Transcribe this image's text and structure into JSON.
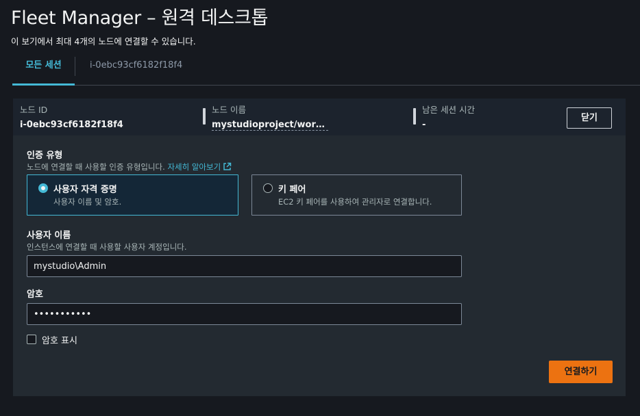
{
  "page": {
    "title": "Fleet Manager – 원격 데스크톱",
    "subtitle": "이 보기에서 최대 4개의 노드에 연결할 수 있습니다."
  },
  "tabs": [
    {
      "label": "모든 세션",
      "active": true
    },
    {
      "label": "i-0ebc93cf6182f18f4",
      "active": false
    }
  ],
  "header": {
    "node_id_label": "노드 ID",
    "node_id_value": "i-0ebc93cf6182f18f4",
    "node_name_label": "노드 이름",
    "node_name_value": "mystudioproject/workst...",
    "remaining_label": "남은 세션 시간",
    "remaining_value": "-",
    "close_label": "닫기"
  },
  "auth": {
    "label": "인증 유형",
    "description": "노드에 연결할 때 사용할 인증 유형입니다.",
    "learn_more": "자세히 알아보기",
    "options": [
      {
        "title": "사용자 자격 증명",
        "description": "사용자 이름 및 암호.",
        "selected": true
      },
      {
        "title": "키 페어",
        "description": "EC2 키 페어를 사용하여 관리자로 연결합니다.",
        "selected": false
      }
    ]
  },
  "username": {
    "label": "사용자 이름",
    "description": "인스턴스에 연결할 때 사용할 사용자 계정입니다.",
    "value": "mystudio\\Admin"
  },
  "password": {
    "label": "암호",
    "value": "•••••••••••"
  },
  "show_password": {
    "label": "암호 표시",
    "checked": false
  },
  "connect_label": "연결하기",
  "colors": {
    "accent": "#44b9d6",
    "primary_button": "#ec7211",
    "background": "#16191f",
    "panel": "#232a31"
  }
}
